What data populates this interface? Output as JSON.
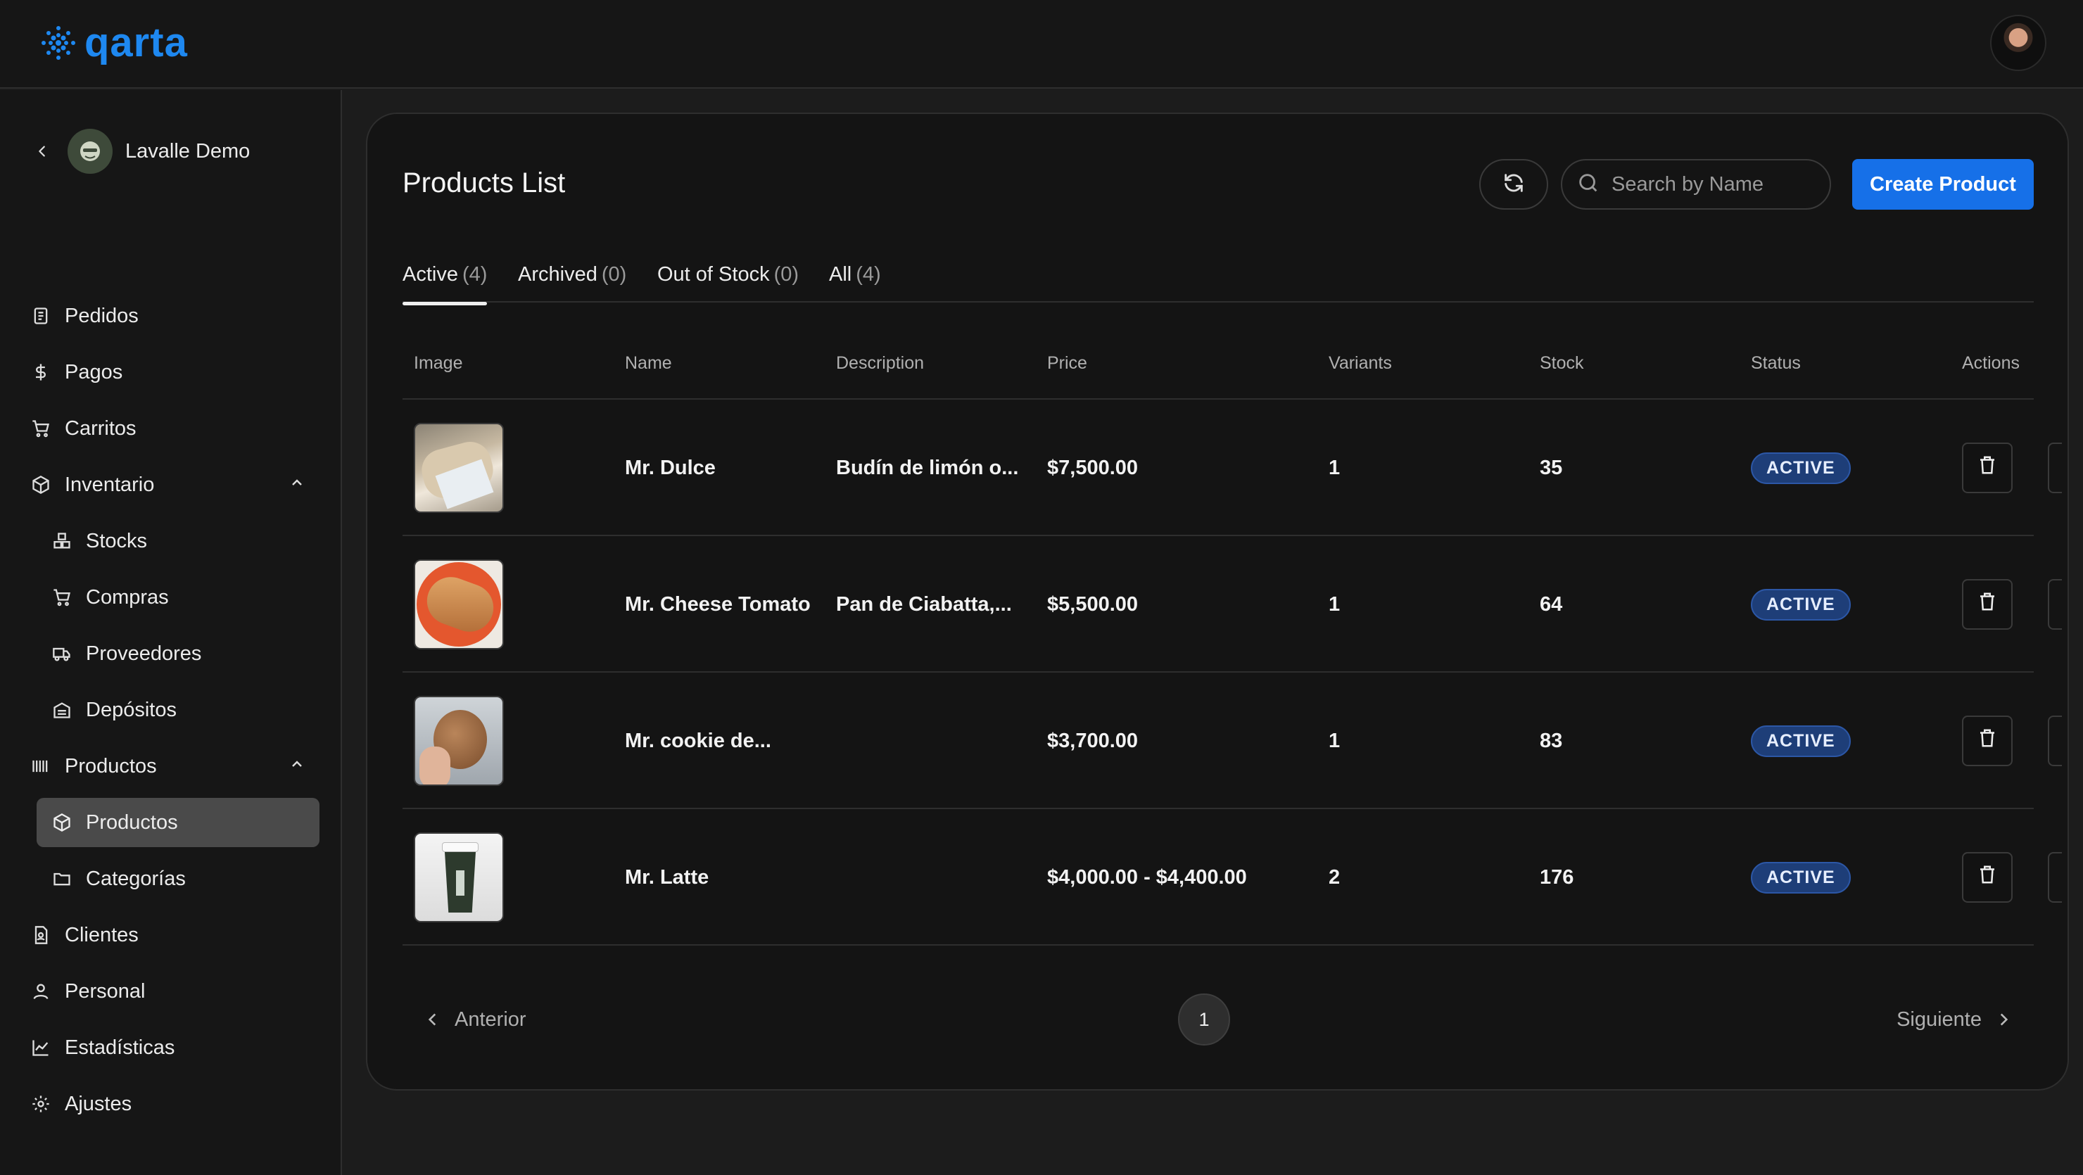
{
  "brand": {
    "name": "qarta",
    "accent": "#1e88f0"
  },
  "org": {
    "name": "Lavalle Demo"
  },
  "sidebar": {
    "items": [
      {
        "label": "Pedidos",
        "icon": "receipt-icon"
      },
      {
        "label": "Pagos",
        "icon": "dollar-icon"
      },
      {
        "label": "Carritos",
        "icon": "cart-icon"
      },
      {
        "label": "Inventario",
        "icon": "package-icon",
        "expanded": true
      },
      {
        "label": "Stocks",
        "icon": "boxes-icon"
      },
      {
        "label": "Compras",
        "icon": "cart-icon"
      },
      {
        "label": "Proveedores",
        "icon": "truck-icon"
      },
      {
        "label": "Depósitos",
        "icon": "warehouse-icon"
      },
      {
        "label": "Productos",
        "icon": "barcode-icon",
        "expanded": true
      },
      {
        "label": "Productos",
        "icon": "box-icon",
        "active": true
      },
      {
        "label": "Categorías",
        "icon": "folder-icon"
      },
      {
        "label": "Clientes",
        "icon": "contact-icon"
      },
      {
        "label": "Personal",
        "icon": "user-icon"
      },
      {
        "label": "Estadísticas",
        "icon": "chart-icon"
      },
      {
        "label": "Ajustes",
        "icon": "gear-icon"
      }
    ]
  },
  "main": {
    "title": "Products List",
    "search": {
      "placeholder": "Search by Name",
      "value": ""
    },
    "create_label": "Create Product",
    "tabs": [
      {
        "label": "Active",
        "count": "(4)",
        "active": true
      },
      {
        "label": "Archived",
        "count": "(0)"
      },
      {
        "label": "Out of Stock",
        "count": "(0)"
      },
      {
        "label": "All",
        "count": "(4)"
      }
    ],
    "columns": [
      "Image",
      "Name",
      "Description",
      "Price",
      "Variants",
      "Stock",
      "Status",
      "Actions"
    ],
    "rows": [
      {
        "name": "Mr. Dulce",
        "description": "Budín de limón o...",
        "price": "$7,500.00",
        "variants": "1",
        "stock": "35",
        "status": "ACTIVE"
      },
      {
        "name": "Mr. Cheese Tomato",
        "description": "Pan de Ciabatta,...",
        "price": "$5,500.00",
        "variants": "1",
        "stock": "64",
        "status": "ACTIVE"
      },
      {
        "name": "Mr. cookie de...",
        "description": "",
        "price": "$3,700.00",
        "variants": "1",
        "stock": "83",
        "status": "ACTIVE"
      },
      {
        "name": "Mr. Latte",
        "description": "",
        "price": "$4,000.00 - $4,400.00",
        "variants": "2",
        "stock": "176",
        "status": "ACTIVE"
      }
    ],
    "pagination": {
      "prev": "Anterior",
      "next": "Siguiente",
      "current": "1"
    }
  }
}
